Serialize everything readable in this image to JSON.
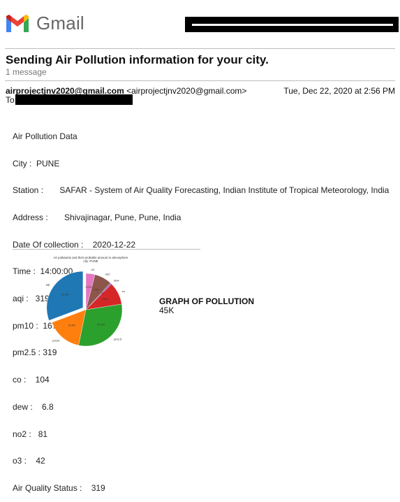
{
  "app": {
    "name": "Gmail"
  },
  "email": {
    "subject": "Sending Air Pollution information for your city.",
    "message_count": "1 message",
    "from_name": "airprojectjnv2020@gmail.com",
    "from_address": "<airprojectjnv2020@gmail.com>",
    "date": "Tue, Dec 22, 2020 at 2:56 PM",
    "to_label": "To:"
  },
  "body": {
    "lines": [
      "Air Pollution Data",
      "City :  PUNE",
      "Station :       SAFAR - System of Air Quality Forecasting, Indian Institute of Tropical Meteorology, India",
      "Address :       Shivajinagar, Pune, Pune, India",
      "Date Of collection :    2020-12-22",
      "Time :  14:00:00",
      "aqi :   319",
      "pm10 :  167",
      "pm2.5 : 319",
      "co :    104",
      "dew :    6.8",
      "no2 :   81",
      "o3 :    42",
      "Air Quality Status :    319"
    ]
  },
  "attachment": {
    "title": "GRAPH OF POLLUTION",
    "size": "45K"
  },
  "chart_data": {
    "type": "pie",
    "title": "Air pollutants and their probable amount in atmosphere",
    "subtitle": "city: PUNE",
    "categories": [
      "aqi",
      "pm10",
      "pm2.5",
      "co",
      "dew",
      "no2",
      "o3"
    ],
    "values": [
      319,
      167,
      319,
      104,
      6.8,
      81,
      42
    ],
    "percent_labels": [
      "30.13%",
      "15.78%",
      "30.13%",
      "9.82%",
      "0.64%",
      "7.65%",
      "3.97%"
    ],
    "colors": [
      "#1f77b4",
      "#ff7f0e",
      "#2ca02c",
      "#d62728",
      "#9467bd",
      "#8c564b",
      "#e377c2"
    ],
    "start_angle_deg": 90,
    "explode_index": 0
  }
}
